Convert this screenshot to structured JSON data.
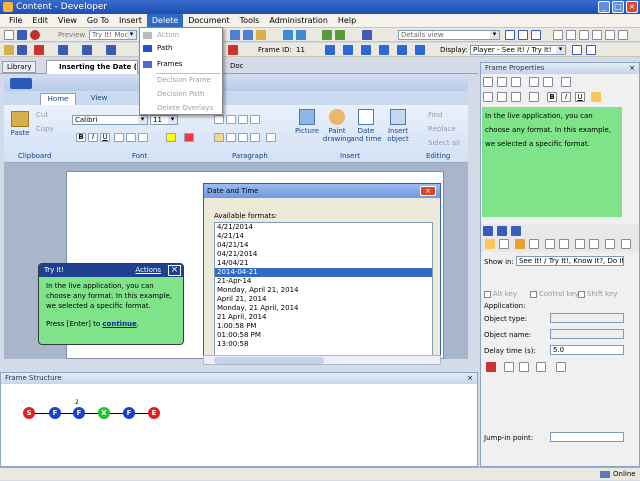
{
  "window": {
    "title": "Content - Developer"
  },
  "menu": [
    "File",
    "Edit",
    "View",
    "Go To",
    "Insert",
    "Delete",
    "Document",
    "Tools",
    "Administration",
    "Help"
  ],
  "toolbar1": {
    "preview_label": "Preview",
    "mode_combo": "Try It! Mode",
    "view_combo": "Details view"
  },
  "toolbar2": {
    "frame_id_label": "Frame ID:",
    "frame_id_value": "11",
    "display_label": "Display:",
    "display_value": "Player - See It! / Try It!"
  },
  "delete_menu": {
    "items": [
      {
        "label": "Action",
        "enabled": false
      },
      {
        "label": "Path",
        "enabled": true
      },
      {
        "label": "Frames",
        "enabled": true
      },
      {
        "label": "Decision Frame",
        "enabled": false
      },
      {
        "label": "Decision Path",
        "enabled": false
      },
      {
        "label": "Delete Overlays",
        "enabled": false
      }
    ]
  },
  "tabs": {
    "library": "Library",
    "topic": "Inserting the Date (Re...",
    "doc": "Doc"
  },
  "ribbon": {
    "tabs": [
      "Home",
      "View"
    ],
    "font_name": "Calibri",
    "font_size": "11",
    "groups": {
      "clipboard": "Clipboard",
      "font": "Font",
      "paragraph": "Paragraph",
      "insert": "Insert",
      "editing": "Editing"
    },
    "buttons": {
      "paste": "Paste",
      "cut": "Cut",
      "copy": "Copy",
      "picture": "Picture",
      "paint_drawing": "Paint drawing",
      "date_time": "Date and time",
      "insert_object": "Insert object",
      "find": "Find",
      "replace": "Replace",
      "select_all": "Select all"
    }
  },
  "dialog": {
    "title": "Date and Time",
    "formats_label": "Available formats:",
    "formats": [
      "4/21/2014",
      "4/21/14",
      "04/21/14",
      "04/21/2014",
      "14/04/21",
      "2014-04-21",
      "21-Apr-14",
      "Monday, April 21, 2014",
      "April 21, 2014",
      "Monday, 21 April, 2014",
      "21 April, 2014",
      "1:00:58 PM",
      "01:00:58 PM",
      "13:00:58"
    ],
    "selected_index": 5
  },
  "tryit": {
    "title": "Try It!",
    "actions": "Actions",
    "body": "In the live application, you can choose any format. In this example, we selected a specific format.",
    "prompt": "Press [Enter] to",
    "continue": "continue",
    "prompt_end": "."
  },
  "frame_structure": {
    "title": "Frame Structure",
    "nodes": [
      {
        "label": "S",
        "color": "#e02020"
      },
      {
        "label": "F",
        "color": "#1a3fd6"
      },
      {
        "label": "F",
        "color": "#1a3fd6"
      },
      {
        "label": "X",
        "color": "#22c22a"
      },
      {
        "label": "F",
        "color": "#1a3fd6"
      },
      {
        "label": "E",
        "color": "#e02020"
      }
    ],
    "branch_label": "2"
  },
  "frame_properties": {
    "title": "Frame Properties",
    "text": "In the live application, you can choose any format. In this example, we selected a specific format.",
    "show_in_label": "Show in:",
    "show_in_value": "See It! / Try It!, Know It?, Do It!",
    "alt_key": "Alt key",
    "control_key": "Control key",
    "shift_key": "Shift key",
    "application": "Application:",
    "object_type": "Object type:",
    "object_name": "Object name:",
    "delay_time": "Delay time (s):",
    "delay_value": "5.0",
    "jump_in": "Jump-in point:"
  },
  "status": {
    "online": "Online"
  }
}
